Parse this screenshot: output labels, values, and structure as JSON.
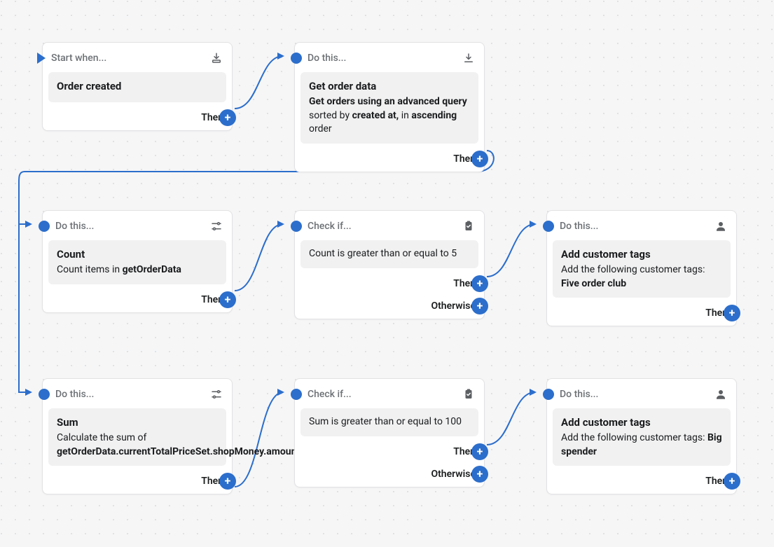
{
  "labels": {
    "start_when": "Start when...",
    "do_this": "Do this...",
    "check_if": "Check if...",
    "then": "Then",
    "otherwise": "Otherwise"
  },
  "nodes": {
    "trigger": {
      "title": "Order created"
    },
    "get_order_data": {
      "title": "Get order data",
      "desc_parts": {
        "b1": "Get orders using an advanced query",
        "t1": " sorted by ",
        "b2": "created at,",
        "t2": " in ",
        "b3": "ascending",
        "t3": " order"
      }
    },
    "count": {
      "title": "Count",
      "desc_t1": "Count items in ",
      "desc_b1": "getOrderData"
    },
    "check_count": {
      "condition": "Count is greater than or equal to 5"
    },
    "tag_five": {
      "title": "Add customer tags",
      "desc_t1": "Add the following customer tags: ",
      "desc_b1": "Five order club"
    },
    "sum": {
      "title": "Sum",
      "desc_t1": "Calculate the sum of ",
      "desc_b1": "getOrderData.currentTotalPriceSet.shopMoney.amount"
    },
    "check_sum": {
      "condition": "Sum is greater than or equal to 100"
    },
    "tag_big": {
      "title": "Add customer tags",
      "desc_t1": "Add the following customer tags: ",
      "desc_b1": "Big spender"
    }
  }
}
